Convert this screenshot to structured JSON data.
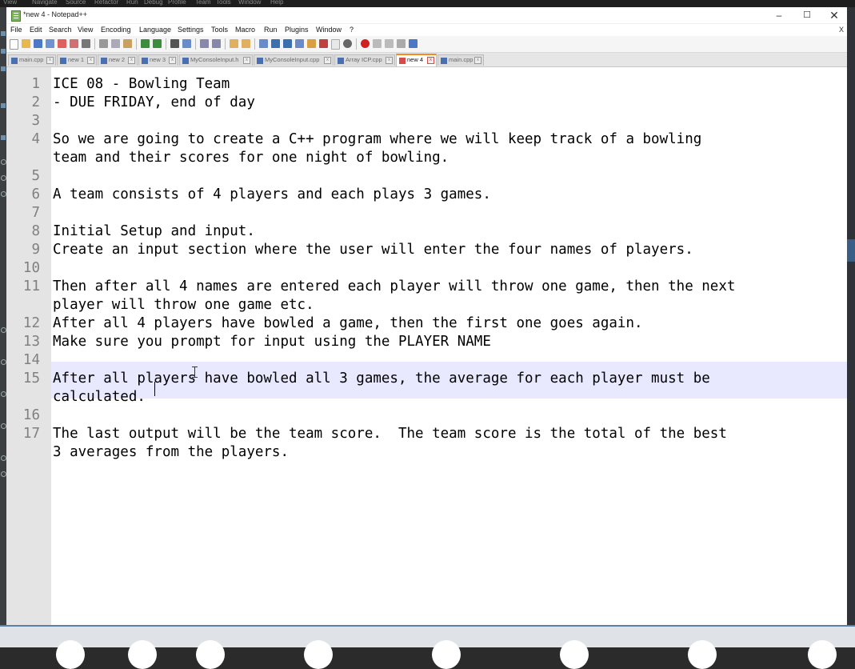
{
  "window": {
    "title": "*new 4 - Notepad++",
    "min_glyph": "–",
    "max_glyph": "☐",
    "close_glyph": "✕"
  },
  "menu": {
    "items": [
      "File",
      "Edit",
      "Search",
      "View",
      "Encoding",
      "Language",
      "Settings",
      "Tools",
      "Macro",
      "Run",
      "Plugins",
      "Window",
      "?"
    ],
    "close_x": "X"
  },
  "tabs": [
    {
      "label": "main.cpp",
      "active": false
    },
    {
      "label": "new 1",
      "active": false
    },
    {
      "label": "new 2",
      "active": false
    },
    {
      "label": "new 3",
      "active": false
    },
    {
      "label": "MyConsoleInput.h",
      "active": false
    },
    {
      "label": "MyConsoleInput.cpp",
      "active": false
    },
    {
      "label": "Array ICP.cpp",
      "active": false
    },
    {
      "label": "new 4",
      "active": true
    },
    {
      "label": "main.cpp",
      "active": false
    }
  ],
  "tab_close_glyph": "x",
  "editor": {
    "current_line": 15,
    "rows": [
      {
        "num": "1",
        "text": "ICE 08 - Bowling Team"
      },
      {
        "num": "2",
        "text": "- DUE FRIDAY, end of day"
      },
      {
        "num": "3",
        "text": ""
      },
      {
        "num": "4",
        "text": "So we are going to create a C++ program where we will keep track of a bowling"
      },
      {
        "num": "",
        "text": "team and their scores for one night of bowling."
      },
      {
        "num": "5",
        "text": ""
      },
      {
        "num": "6",
        "text": "A team consists of 4 players and each plays 3 games."
      },
      {
        "num": "7",
        "text": ""
      },
      {
        "num": "8",
        "text": "Initial Setup and input."
      },
      {
        "num": "9",
        "text": "Create an input section where the user will enter the four names of players."
      },
      {
        "num": "10",
        "text": ""
      },
      {
        "num": "11",
        "text": "Then after all 4 names are entered each player will throw one game, then the next"
      },
      {
        "num": "",
        "text": "player will throw one game etc."
      },
      {
        "num": "12",
        "text": "After all 4 players have bowled a game, then the first one goes again."
      },
      {
        "num": "13",
        "text": "Make sure you prompt for input using the PLAYER NAME"
      },
      {
        "num": "14",
        "text": ""
      },
      {
        "num": "15",
        "text": "After all players have bowled all 3 games, the average for each player must be"
      },
      {
        "num": "",
        "text": "calculated."
      },
      {
        "num": "16",
        "text": ""
      },
      {
        "num": "17",
        "text": "The last output will be the team score.  The team score is the total of the best"
      },
      {
        "num": "",
        "text": "3 averages from the players."
      }
    ]
  },
  "colors": {
    "current_line_highlight": "#e8e8ff",
    "active_tab_accent": "#f58a1f",
    "gutter_bg": "#e4e4e4",
    "line_number": "#808080"
  }
}
